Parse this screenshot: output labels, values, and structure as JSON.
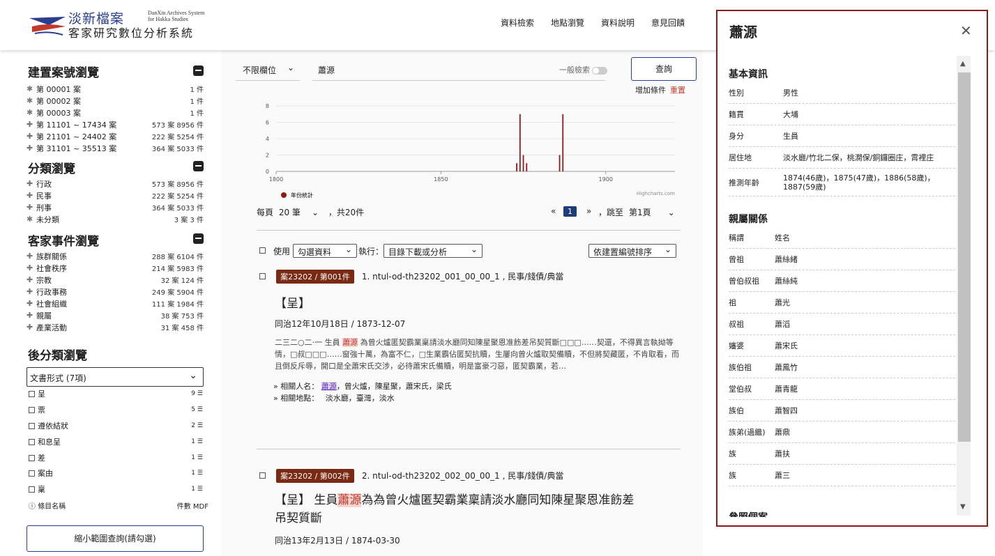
{
  "header": {
    "logo_line1": "淡新檔案",
    "logo_line2": "客家研究數位分析系統",
    "logo_en1": "DanXin Archives System",
    "logo_en2": "for Hakka Studies",
    "nav": [
      "資料檢索",
      "地點瀏覽",
      "資料說明",
      "意見回饋"
    ]
  },
  "sidebar": {
    "case_title": "建置案號瀏覽",
    "cases": [
      {
        "label": "第 00001 案",
        "count": "1 件"
      },
      {
        "label": "第 00002 案",
        "count": "1 件"
      },
      {
        "label": "第 00003 案",
        "count": "1 件"
      },
      {
        "label": "第 11101 ~ 17434 案",
        "count": "573 案 8956 件"
      },
      {
        "label": "第 21101 ~ 24402 案",
        "count": "222 案 5254 件"
      },
      {
        "label": "第 31101 ~ 35513 案",
        "count": "364 案 5033 件"
      }
    ],
    "cat_title": "分類瀏覽",
    "cats": [
      {
        "label": "行政",
        "count": "573 案 8956 件"
      },
      {
        "label": "民事",
        "count": "222 案 5254 件"
      },
      {
        "label": "刑事",
        "count": "364 案 5033 件"
      },
      {
        "label": "未分類",
        "count": "3 案 3 件"
      }
    ],
    "hakka_title": "客家事件瀏覽",
    "hakka": [
      {
        "label": "族群關係",
        "count": "288 案 6104 件"
      },
      {
        "label": "社會秩序",
        "count": "214 案 5983 件"
      },
      {
        "label": "宗教",
        "count": "32 案 124 件"
      },
      {
        "label": "行政事務",
        "count": "249 案 5904 件"
      },
      {
        "label": "社會組織",
        "count": "111 案 1984 件"
      },
      {
        "label": "親屬",
        "count": "38 案 753 件"
      },
      {
        "label": "產業活動",
        "count": "31 案 458 件"
      }
    ],
    "post_title": "後分類瀏覽",
    "doc_select": "文書形式 (7項)",
    "docs": [
      {
        "label": "呈",
        "count": "9"
      },
      {
        "label": "票",
        "count": "5"
      },
      {
        "label": "遵依結狀",
        "count": "2"
      },
      {
        "label": "和息呈",
        "count": "1"
      },
      {
        "label": "差",
        "count": "1"
      },
      {
        "label": "案由",
        "count": "1"
      },
      {
        "label": "稟",
        "count": "1"
      }
    ],
    "footer_left": "條目名稱",
    "footer_right": "件數 MDF",
    "narrow_btn": "縮小範圍查詢(請勾選)"
  },
  "search": {
    "scope": "不限欄位",
    "query": "蕭源",
    "general": "一般檢索",
    "button": "查詢",
    "add": "增加條件",
    "reset": "重置"
  },
  "chart_data": {
    "type": "bar",
    "x_ticks": [
      "1800",
      "1850",
      "1900"
    ],
    "y_ticks": [
      "0",
      "2",
      "4",
      "6",
      "8"
    ],
    "ylim": [
      0,
      8
    ],
    "xlim": [
      1800,
      1921
    ],
    "series": [
      {
        "name": "年份統計",
        "points": [
          {
            "x": 1873,
            "y": 1
          },
          {
            "x": 1874,
            "y": 7
          },
          {
            "x": 1875,
            "y": 2
          },
          {
            "x": 1876,
            "y": 1
          },
          {
            "x": 1886,
            "y": 2
          },
          {
            "x": 1887,
            "y": 7
          }
        ]
      }
    ],
    "credit": "Highcharts.com",
    "color": "#8e1b1b"
  },
  "pager": {
    "per_page": "每頁",
    "per_page_val": "20 筆",
    "total": "，共20件",
    "prev": "«",
    "page": "1",
    "next": "»",
    "jump": "，跳至",
    "jump_val": "第1頁"
  },
  "controls": {
    "use": "使用",
    "select_mode": "勾選資料",
    "exec": "執行：",
    "action": "目錄下載或分析",
    "sort": "依建置編號排序"
  },
  "results": [
    {
      "tag": "案23202 / 第001件",
      "id": "1.  ntul-od-th23202_001_00_00_1 , 民事/錢債/典當",
      "title": "【呈】",
      "date": "同治12年10月18日 / 1873-12-07",
      "body_a": "二三二○二·一 生員 ",
      "body_hl": "蕭源",
      "body_b": " 為曾火爐匿契霸業稟請淡水廳同知陳星聚恩准飭差吊契質斷□□□……契還，不得異言執拗等情，□叔□□□……窗強十萬，為富不仁，□生業霸佔匿契抗贖，生屢向曾火爐取契備贖，不但將契藏匿，不肯取看，而且倒反斥辱，開口是全蕭宋氏交涉，必待蕭宋氏備贖，明是富豪刁惡，匿契霸業，若…",
      "people_label": "» 相關人名：",
      "people_hl": "蕭源",
      "people_rest": "，曾火爐，陳星聚，蕭宋氏，梁氏",
      "places_label": "» 相關地點：",
      "places": "淡水廳，臺灣，淡水"
    },
    {
      "tag": "案23202 / 第002件",
      "id": "2.  ntul-od-th23202_002_00_00_1 , 民事/錢債/典當",
      "title_a": "【呈】 生員",
      "title_hl": "蕭源",
      "title_b": "為為曾火爐匿契霸業稟請淡水廳同知陳星聚恩准飭差",
      "title_c": "吊契質斷",
      "date": "同治13年2月13日 / 1874-03-30"
    }
  ],
  "panel": {
    "title": "蕭源",
    "basic_title": "基本資訊",
    "basic": [
      {
        "k": "性別",
        "v": "男性"
      },
      {
        "k": "籍貫",
        "v": "大埔"
      },
      {
        "k": "身分",
        "v": "生員"
      },
      {
        "k": "居住地",
        "v": "淡水廳/竹北二保，桃澗保/銅鑼圈庄，霄裡庄"
      },
      {
        "k": "推測年齡",
        "v": "1874(46歲)，1875(47歲)，1886(58歲)，1887(59歲)"
      }
    ],
    "kin_title": "親屬關係",
    "kin_head": {
      "k": "稱謂",
      "v": "姓名"
    },
    "kin": [
      {
        "k": "曾祖",
        "v": "蕭絲緒"
      },
      {
        "k": "曾伯叔祖",
        "v": "蕭絲純"
      },
      {
        "k": "祖",
        "v": "蕭光"
      },
      {
        "k": "叔祖",
        "v": "蕭滔"
      },
      {
        "k": "嬸婆",
        "v": "蕭宋氏"
      },
      {
        "k": "族伯祖",
        "v": "蕭鳳竹"
      },
      {
        "k": "堂伯叔",
        "v": "蕭青龍"
      },
      {
        "k": "族伯",
        "v": "蕭智四"
      },
      {
        "k": "族弟(過繼)",
        "v": "蕭鼎"
      },
      {
        "k": "族",
        "v": "蕭扶"
      },
      {
        "k": "族",
        "v": "蕭三"
      }
    ],
    "more_title": "參照個案"
  }
}
